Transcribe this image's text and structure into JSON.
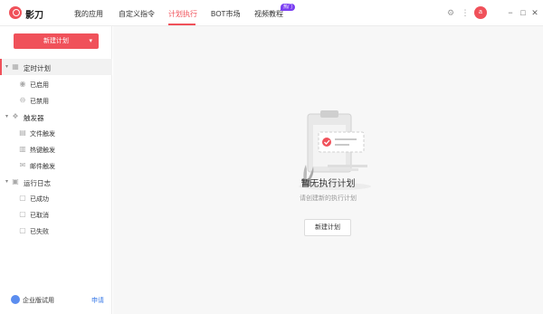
{
  "app": {
    "name": "影刀"
  },
  "nav": {
    "tabs": [
      {
        "label": "我的应用"
      },
      {
        "label": "自定义指令"
      },
      {
        "label": "计划执行"
      },
      {
        "label": "BOT市场"
      },
      {
        "label": "视频教程"
      }
    ],
    "active_tab": "计划执行",
    "hot_badge": "热门"
  },
  "user": {
    "avatar_text": "a"
  },
  "sidebar": {
    "new_plan_label": "新建计划",
    "groups": [
      {
        "label": "定时计划",
        "items": [
          {
            "label": "已启用"
          },
          {
            "label": "已禁用"
          }
        ]
      },
      {
        "label": "触发器",
        "items": [
          {
            "label": "文件触发"
          },
          {
            "label": "热键触发"
          },
          {
            "label": "邮件触发"
          }
        ]
      },
      {
        "label": "运行日志",
        "items": [
          {
            "label": "已成功"
          },
          {
            "label": "已取消"
          },
          {
            "label": "已失败"
          }
        ]
      }
    ],
    "footer": {
      "label": "企业版试用",
      "link": "申请"
    }
  },
  "empty_state": {
    "title": "暂无执行计划",
    "subtitle": "请创建新的执行计划",
    "button": "新建计划"
  },
  "colors": {
    "accent": "#f0515a",
    "link": "#3a7be8",
    "hot_badge": "#7b3ff2",
    "background": "#f7f7f7"
  }
}
